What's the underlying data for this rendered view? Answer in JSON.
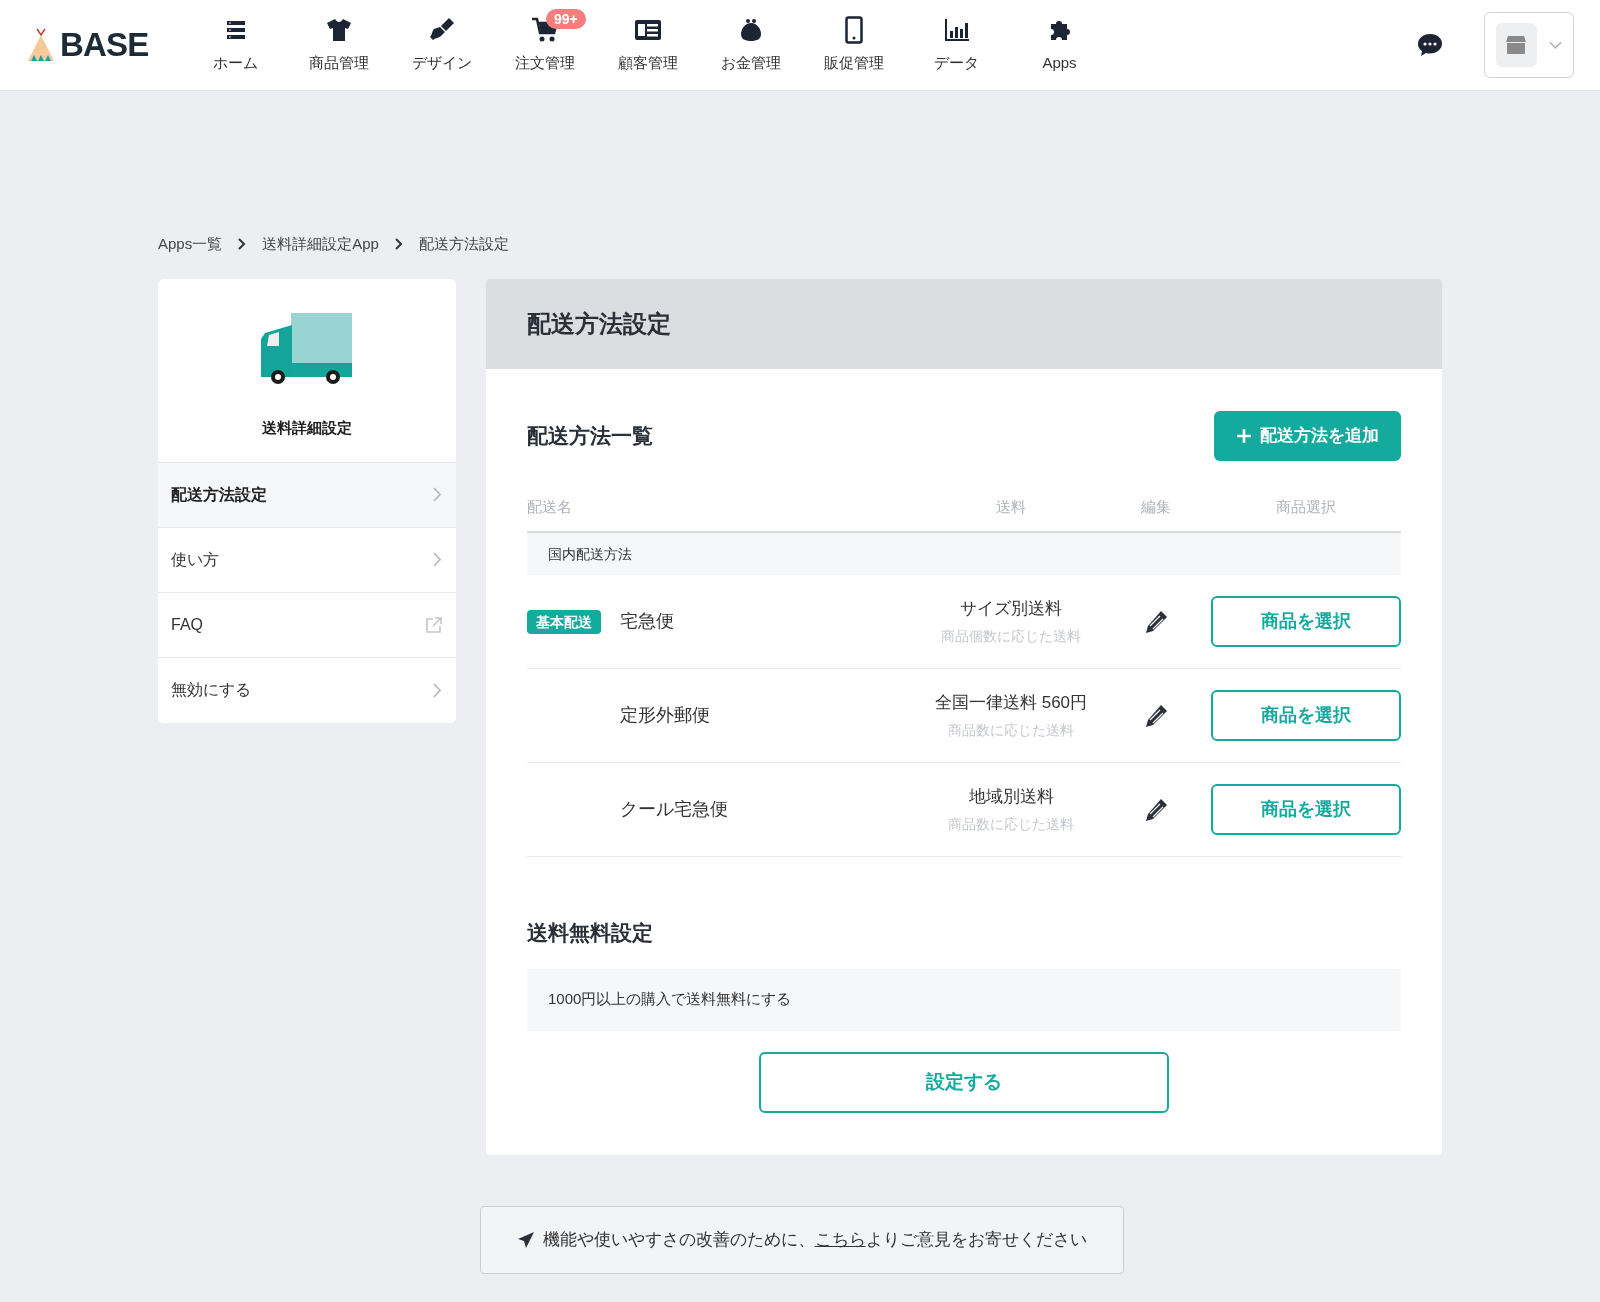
{
  "header": {
    "logo": "BASE",
    "nav": [
      {
        "label": "ホーム",
        "kind": "list"
      },
      {
        "label": "商品管理",
        "kind": "shirt"
      },
      {
        "label": "デザイン",
        "kind": "brush"
      },
      {
        "label": "注文管理",
        "kind": "cart",
        "badge": "99+"
      },
      {
        "label": "顧客管理",
        "kind": "card"
      },
      {
        "label": "お金管理",
        "kind": "purse"
      },
      {
        "label": "販促管理",
        "kind": "phone"
      },
      {
        "label": "データ",
        "kind": "chart"
      },
      {
        "label": "Apps",
        "kind": "puzzle"
      }
    ]
  },
  "breadcrumb": [
    "Apps一覧",
    "送料詳細設定App",
    "配送方法設定"
  ],
  "sidebar": {
    "title": "送料詳細設定",
    "items": [
      {
        "label": "配送方法設定",
        "selected": true,
        "kind": "chevron"
      },
      {
        "label": "使い方",
        "selected": false,
        "kind": "chevron"
      },
      {
        "label": "FAQ",
        "selected": false,
        "kind": "external"
      },
      {
        "label": "無効にする",
        "selected": false,
        "kind": "chevron"
      }
    ]
  },
  "main": {
    "title": "配送方法設定",
    "section_title": "配送方法一覧",
    "add_button": "配送方法を追加",
    "table": {
      "columns": [
        "配送名",
        "送料",
        "編集",
        "商品選択"
      ],
      "group": "国内配送方法",
      "rows": [
        {
          "badge": "基本配送",
          "name": "宅急便",
          "fee": "サイズ別送料",
          "fee_note": "商品個数に応じた送料",
          "button": "商品を選択"
        },
        {
          "name": "定形外郵便",
          "fee": "全国一律送料 560円",
          "fee_note": "商品数に応じた送料",
          "button": "商品を選択"
        },
        {
          "name": "クール宅急便",
          "fee": "地域別送料",
          "fee_note": "商品数に応じた送料",
          "button": "商品を選択"
        }
      ]
    },
    "free_shipping": {
      "title": "送料無料設定",
      "text": "1000円以上の購入で送料無料にする",
      "button": "設定する"
    }
  },
  "feedback": {
    "before": "機能や使いやすさの改善のために、",
    "link": "こちら",
    "after": "よりご意見をお寄せください"
  }
}
